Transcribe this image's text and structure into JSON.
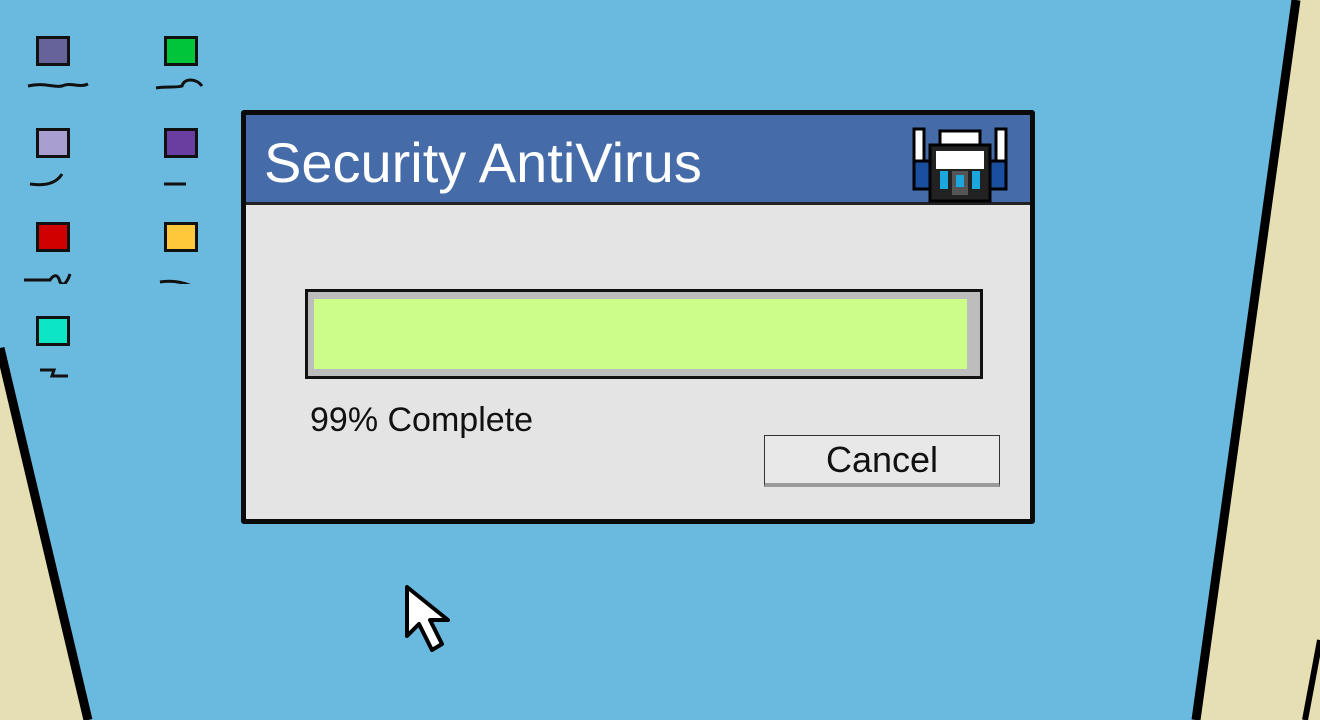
{
  "desktop": {
    "icons": [
      {
        "color": "#66639a"
      },
      {
        "color": "#00c53a"
      },
      {
        "color": "#a89fd0"
      },
      {
        "color": "#6a3ea0"
      },
      {
        "color": "#d00000"
      },
      {
        "color": "#ffc83a"
      },
      {
        "color": "#0de6c6"
      }
    ]
  },
  "dialog": {
    "title": "Security AntiVirus",
    "logo_icon": "robot-icon",
    "progress_percent": 99,
    "status_text": "99% Complete",
    "cancel_label": "Cancel",
    "progress_color": "#ccfd88",
    "titlebar_color": "#456ba8"
  },
  "cursor": {
    "icon": "arrow-cursor-icon"
  }
}
